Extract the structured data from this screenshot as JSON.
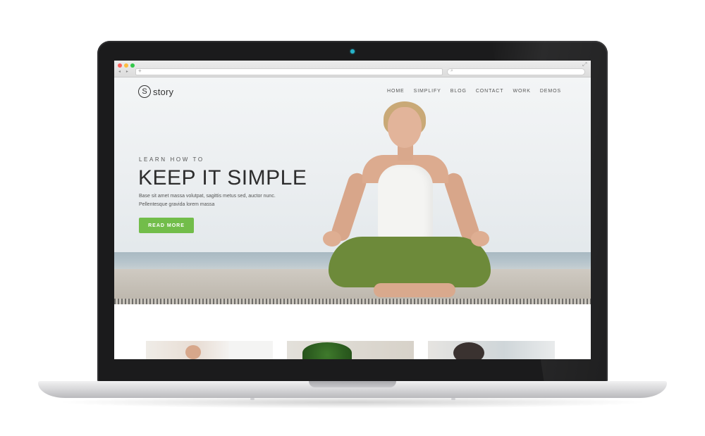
{
  "site": {
    "logo_mark": "S",
    "logo_text": "story",
    "nav": [
      "HOME",
      "SIMPLIFY",
      "BLOG",
      "CONTACT",
      "WORK",
      "DEMOS"
    ]
  },
  "hero": {
    "kicker": "LEARN HOW TO",
    "headline": "KEEP IT SIMPLE",
    "body_line1": "Base sit amet massa volutpat, sagittis metus sed, auctor nunc.",
    "body_line2": "Pellentesque gravida lorem massa",
    "cta_label": "READ MORE",
    "cta_color": "#72bd4a"
  },
  "browser": {
    "nav_arrows": "◂ ▸",
    "address_plus": "+",
    "search_glyph": "⌕",
    "expand_glyph": "⤢"
  },
  "icons": {
    "camera": "camera-icon",
    "close": "close-dot-icon",
    "minimize": "minimize-dot-icon",
    "maximize": "maximize-dot-icon",
    "search": "search-icon",
    "fullscreen": "fullscreen-icon"
  }
}
